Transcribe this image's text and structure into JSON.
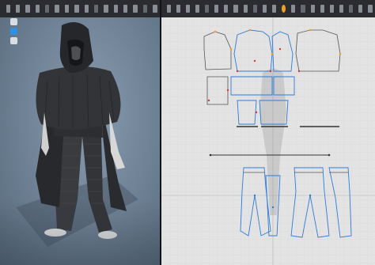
{
  "app": {
    "status_text": "",
    "accent_color": "#f0a020",
    "pattern_line_color": "#2e7bd8",
    "point_color_red": "#d33a2c",
    "point_color_orange": "#f0a020"
  },
  "left_toolbar": {
    "buttons": [
      "move-icon",
      "select-icon",
      "transform-icon",
      "fold-icon",
      "pin-icon",
      "tack-icon",
      "brush-icon",
      "sew-icon",
      "arrange-icon",
      "avatar-icon",
      "fabric-icon",
      "simulate-icon",
      "zoom-icon",
      "settings-icon",
      "layer-icon",
      "camera-icon"
    ]
  },
  "right_toolbar": {
    "buttons": [
      "pointer-icon",
      "edit-point-icon",
      "line-icon",
      "curve-icon",
      "rectangle-icon",
      "polygon-icon",
      "circle-icon",
      "internal-line-icon",
      "trace-icon",
      "dart-icon",
      "seam-icon",
      "grade-icon",
      "sew-2d-icon",
      "notch-icon",
      "layout-icon",
      "sim-2d-icon",
      "render-icon",
      "view-1-icon",
      "view-2-icon",
      "view-3-icon",
      "view-4-icon",
      "zoom-2d-icon"
    ]
  },
  "side_tools": [
    "avatar-visibility-icon",
    "garment-visibility-icon",
    "lighting-icon"
  ]
}
